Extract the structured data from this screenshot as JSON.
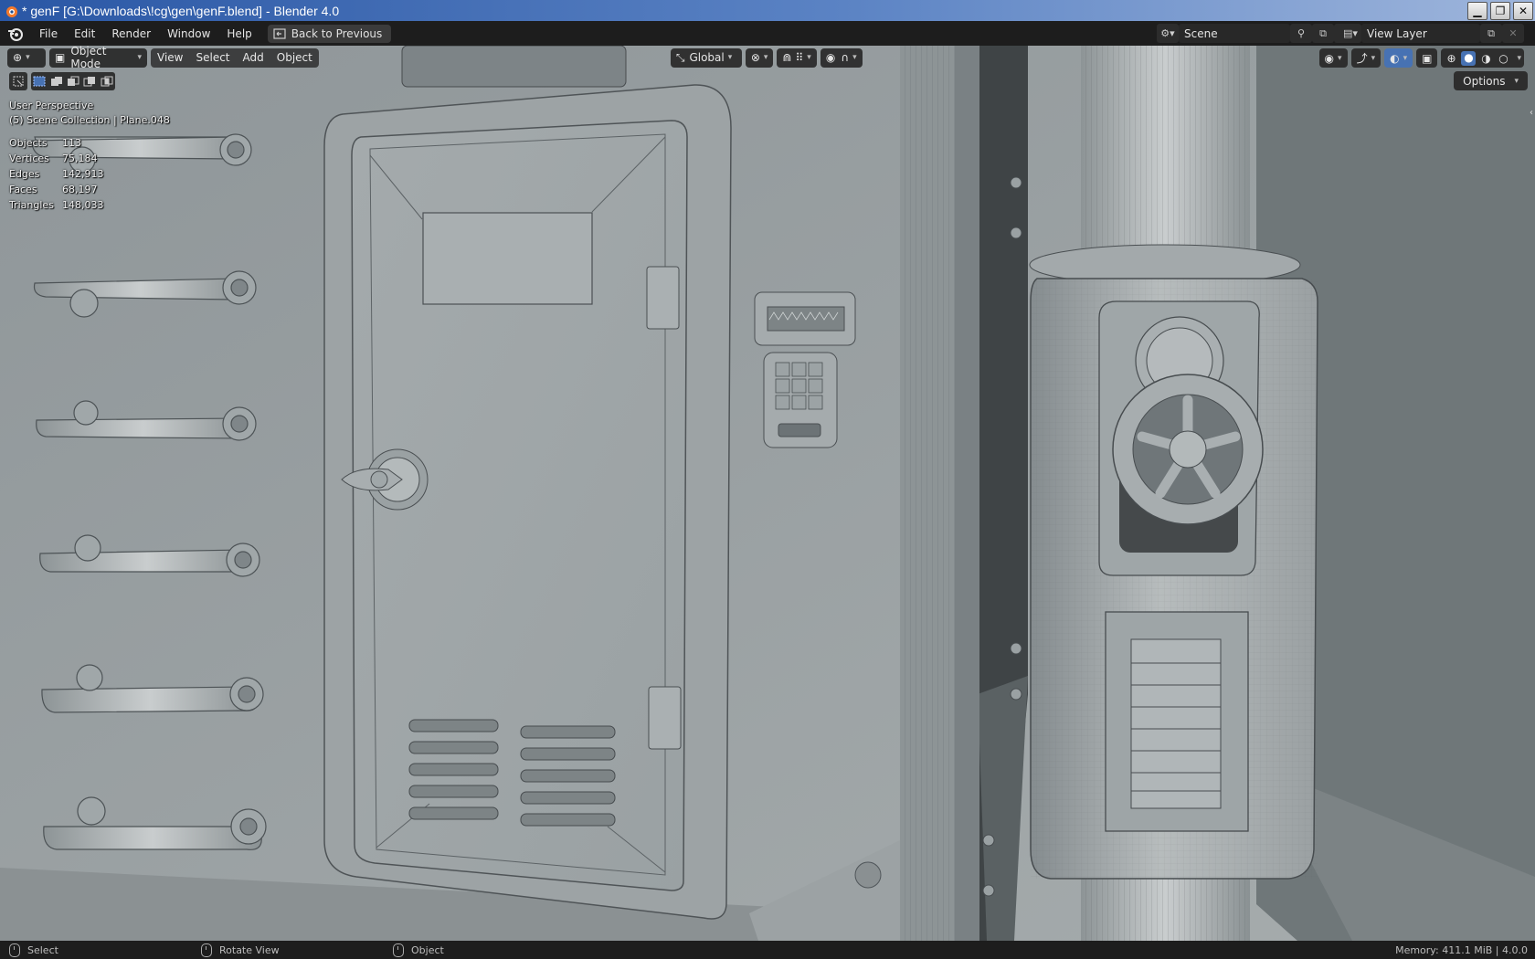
{
  "window": {
    "title": "* genF [G:\\Downloads\\!cg\\gen\\genF.blend] - Blender 4.0",
    "controls": [
      "minimize",
      "maximize",
      "close"
    ]
  },
  "topbar": {
    "menus": [
      "File",
      "Edit",
      "Render",
      "Window",
      "Help"
    ],
    "back_button": "Back to Previous",
    "scene_name": "Scene",
    "view_layer_name": "View Layer"
  },
  "viewport_header": {
    "mode": "Object Mode",
    "menus": [
      "View",
      "Select",
      "Add",
      "Object"
    ],
    "transform_orientation": "Global",
    "options_label": "Options"
  },
  "overlay": {
    "perspective": "User Perspective",
    "collection": "(5) Scene Collection | Plane.048",
    "stats": [
      {
        "label": "Objects",
        "value": "113"
      },
      {
        "label": "Vertices",
        "value": "75,184"
      },
      {
        "label": "Edges",
        "value": "142,913"
      },
      {
        "label": "Faces",
        "value": "68,197"
      },
      {
        "label": "Triangles",
        "value": "148,033"
      }
    ]
  },
  "statusbar": {
    "items": [
      "Select",
      "Rotate View",
      "Object"
    ],
    "memory": "Memory: 411.1 MiB | 4.0.0"
  },
  "colors": {
    "ui_dark": "#1d1d1d",
    "header_panel": "#282828",
    "accent_blue": "#4772b3",
    "mesh_light": "#a9b0b2",
    "mesh_dark": "#6f7679"
  }
}
